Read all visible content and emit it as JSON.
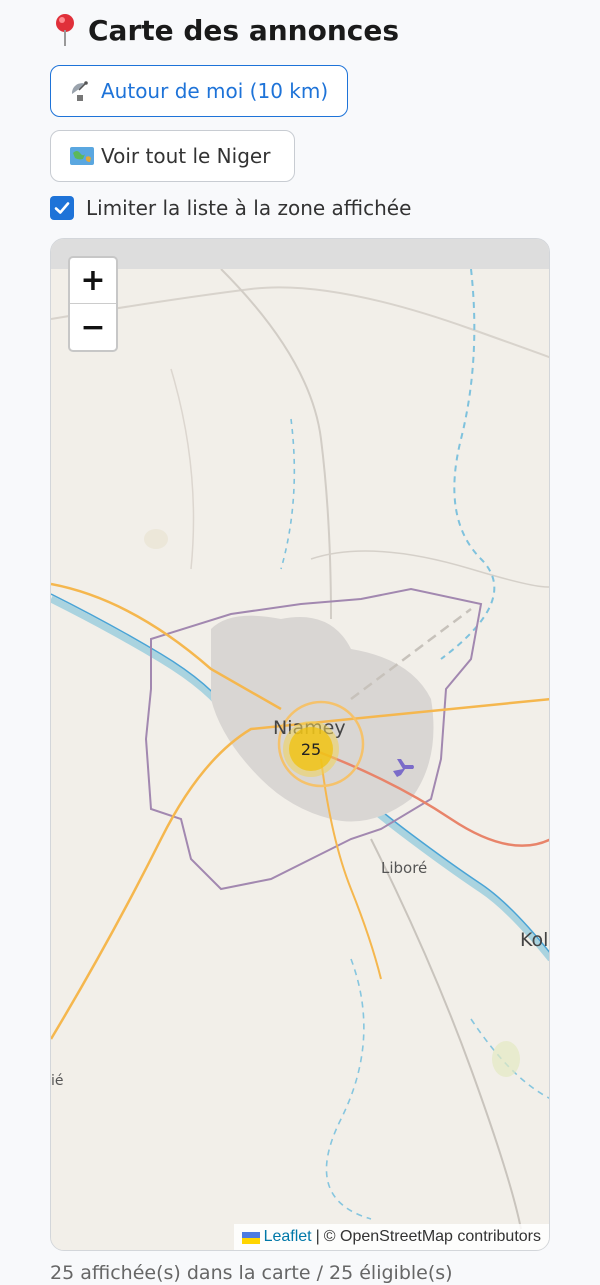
{
  "header": {
    "title": "Carte des annonces",
    "icon": "pin-icon"
  },
  "buttons": {
    "near_me": {
      "label": "Autour de moi (10 km)",
      "icon": "satellite-antenna-icon",
      "color": "#1e73d8"
    },
    "all_niger": {
      "label": "Voir tout le Niger",
      "icon": "world-map-icon"
    }
  },
  "filter": {
    "label": "Limiter la liste à la zone affichée",
    "checked": true
  },
  "map": {
    "zoom_in": "+",
    "zoom_out": "−",
    "cluster_count": "25",
    "cluster_color": "#f0c20c",
    "labels": {
      "city": "Niamey",
      "libore": "Liboré",
      "kol": "Kol",
      "ie": "ié"
    },
    "attribution": {
      "leaflet": "Leaflet",
      "separator": "|",
      "osm": "© OpenStreetMap contributors"
    }
  },
  "status": "25 affichée(s) dans la carte / 25 éligible(s)"
}
